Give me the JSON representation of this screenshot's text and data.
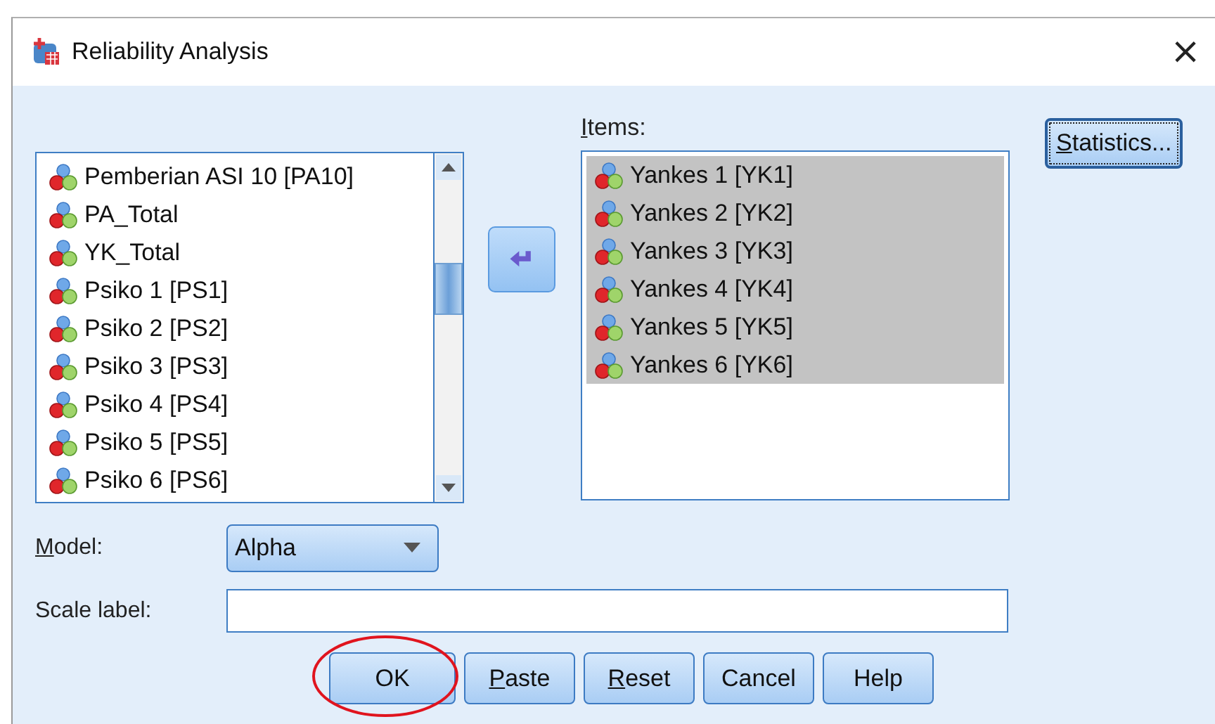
{
  "window": {
    "title": "Reliability Analysis",
    "close": "×"
  },
  "variables": {
    "items": [
      {
        "label": "Pemberian ASI 10 [PA10]",
        "selected": false
      },
      {
        "label": "PA_Total",
        "selected": false
      },
      {
        "label": "YK_Total",
        "selected": false
      },
      {
        "label": "Psiko 1 [PS1]",
        "selected": false
      },
      {
        "label": "Psiko 2 [PS2]",
        "selected": false
      },
      {
        "label": "Psiko 3 [PS3]",
        "selected": false
      },
      {
        "label": "Psiko 4 [PS4]",
        "selected": false
      },
      {
        "label": "Psiko 5 [PS5]",
        "selected": false
      },
      {
        "label": "Psiko 6 [PS6]",
        "selected": false
      }
    ]
  },
  "items_list": {
    "label": "Items:",
    "underlined_first": true,
    "items": [
      {
        "label": "Yankes 1 [YK1]",
        "selected": true
      },
      {
        "label": "Yankes 2 [YK2]",
        "selected": true
      },
      {
        "label": "Yankes 3 [YK3]",
        "selected": true
      },
      {
        "label": "Yankes 4 [YK4]",
        "selected": true
      },
      {
        "label": "Yankes 5 [YK5]",
        "selected": true
      },
      {
        "label": "Yankes 6 [YK6]",
        "selected": true
      }
    ]
  },
  "statistics_button": {
    "label": "Statistics...",
    "underlined_first": true,
    "focused": true
  },
  "model": {
    "label": "Model:",
    "underlined_first": true,
    "value": "Alpha"
  },
  "scale_label": {
    "label": "Scale label:",
    "underlined_first": false
  },
  "buttons": [
    {
      "label": "OK",
      "underlined_first": false,
      "circled": true
    },
    {
      "label": "Paste",
      "underlined_first": true,
      "circled": false
    },
    {
      "label": "Reset",
      "underlined_first": true,
      "circled": false
    },
    {
      "label": "Cancel",
      "underlined_first": false,
      "circled": false
    },
    {
      "label": "Help",
      "underlined_first": false,
      "circled": false
    }
  ]
}
